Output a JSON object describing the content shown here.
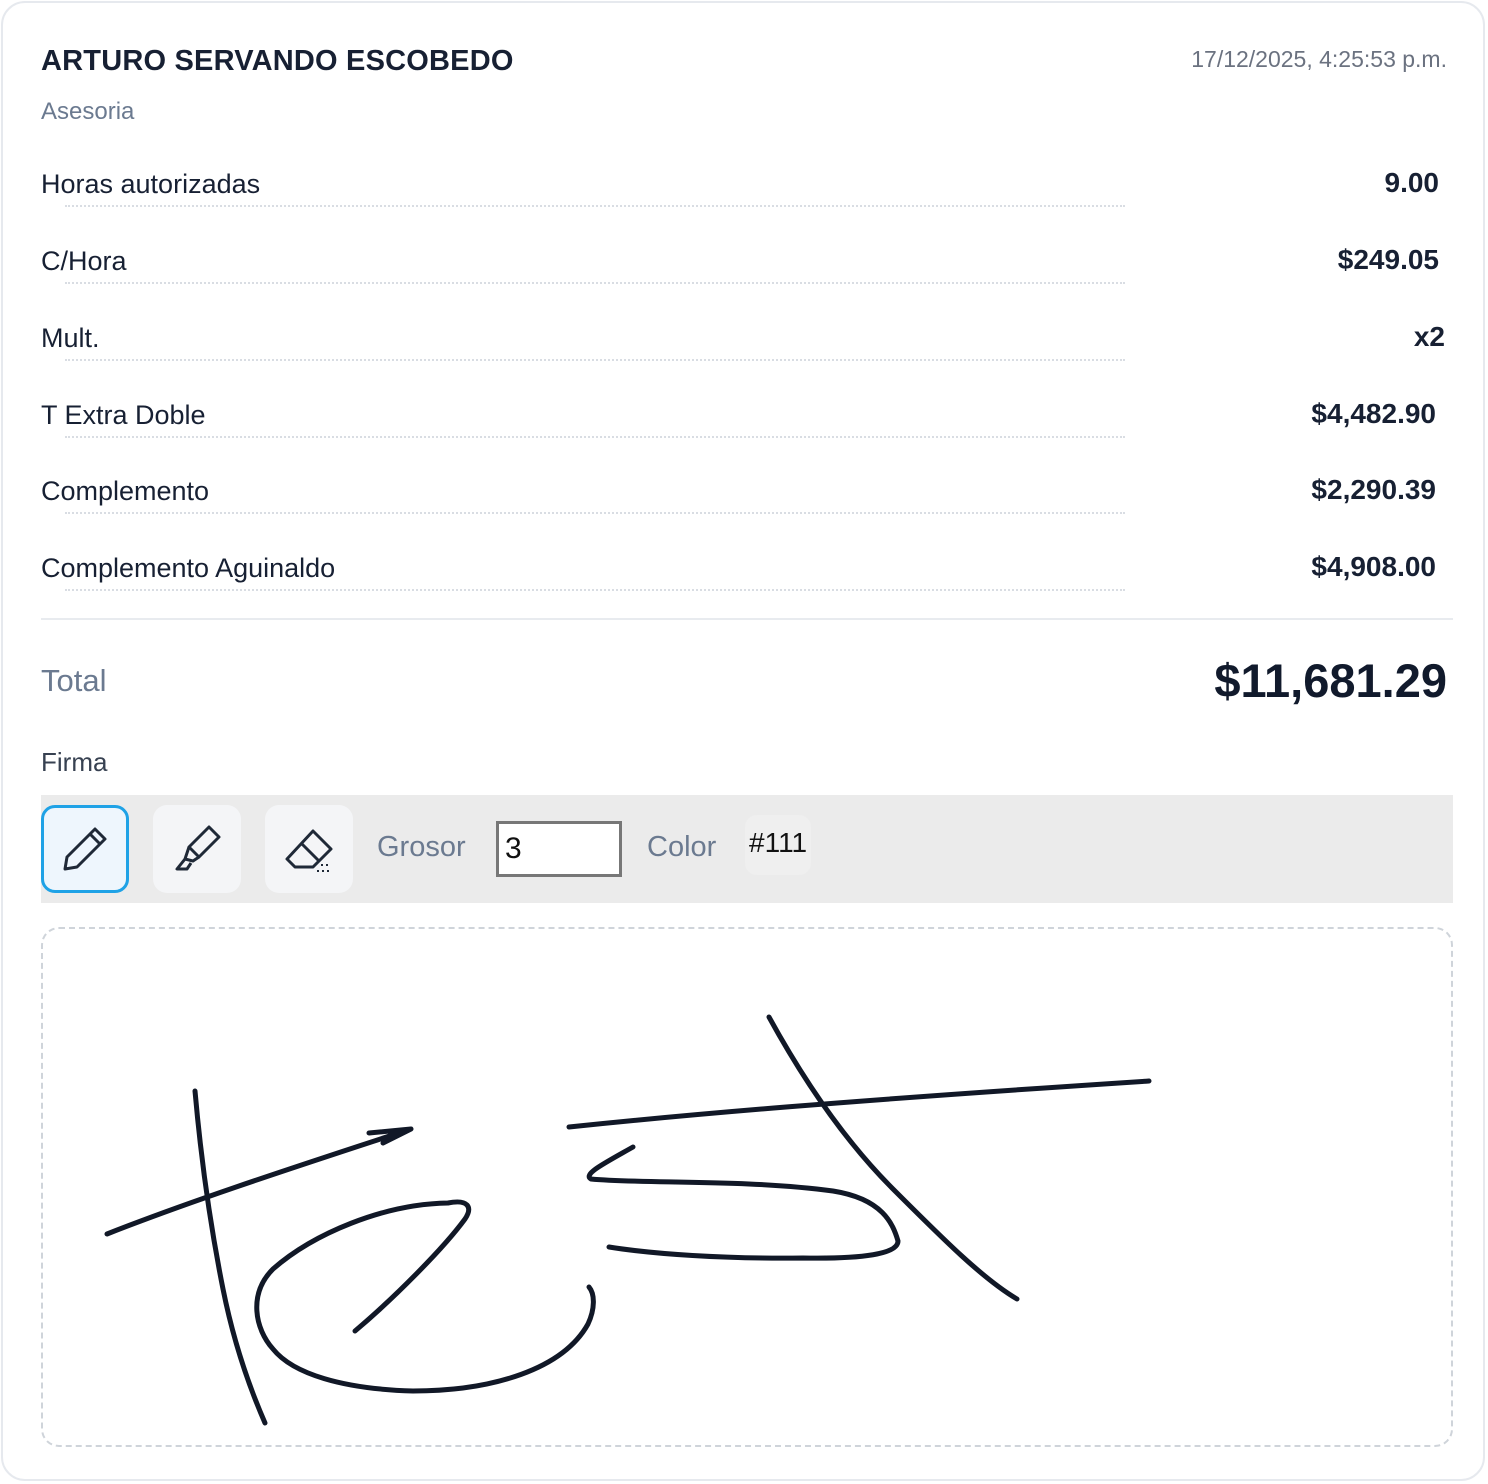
{
  "employee": {
    "name": "ARTURO SERVANDO ESCOBEDO",
    "department": "Asesoria",
    "timestamp": "17/12/2025, 4:25:53 p.m."
  },
  "rows": [
    {
      "label": "Horas autorizadas",
      "value": "9.00"
    },
    {
      "label": "C/Hora",
      "value": "$249.05"
    },
    {
      "label": "Mult.",
      "value": "x2"
    },
    {
      "label": "T Extra Doble",
      "value": "$4,482.90"
    },
    {
      "label": "Complemento",
      "value": "$2,290.39"
    },
    {
      "label": "Complemento Aguinaldo",
      "value": "$4,908.00"
    }
  ],
  "total": {
    "label": "Total",
    "value": "$11,681.29"
  },
  "signature": {
    "label": "Firma",
    "tools": [
      {
        "name": "pen",
        "icon": "pencil-icon",
        "active": true
      },
      {
        "name": "highlighter",
        "icon": "highlighter-icon",
        "active": false
      },
      {
        "name": "eraser",
        "icon": "eraser-icon",
        "active": false
      }
    ],
    "thickness_label": "Grosor",
    "thickness_value": "3",
    "color_label": "Color",
    "color_value": "#111",
    "stroke_color": "#111827"
  }
}
